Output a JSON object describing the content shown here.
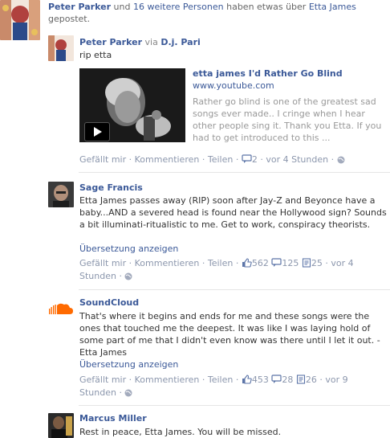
{
  "header": {
    "actor": "Peter Parker",
    "connector": "und",
    "others": "16 weitere Personen",
    "tail": "haben etwas über",
    "topic": "Etta James",
    "tail2": "gepostet."
  },
  "posts": [
    {
      "author": "Peter Parker",
      "via_word": "via",
      "via_name": "D.j. Pari",
      "text": "rip etta",
      "link": {
        "title": "etta james I'd Rather Go Blind",
        "url": "www.youtube.com",
        "description": "Rather go blind is one of the greatest sad songs ever made.. I cringe when I hear other people sing it. Thank you Etta. If you had to get introduced to this ..."
      },
      "actions": {
        "like": "Gefällt mir",
        "comment": "Kommentieren",
        "share": "Teilen",
        "comments": "2",
        "time": "vor 4 Stunden"
      }
    },
    {
      "author": "Sage Francis",
      "text": "Etta James passes away (RIP) soon after Jay-Z and Beyonce have a baby...AND a severed head is found near the Hollywood sign? Sounds a bit illuminati-ritualistic to me. Get to work, conspiracy theorists.",
      "translate": "Übersetzung anzeigen",
      "actions": {
        "like": "Gefällt mir",
        "comment": "Kommentieren",
        "share": "Teilen",
        "likes": "562",
        "comments": "125",
        "shares": "25",
        "time_a": "vor 4",
        "time_b": "Stunden"
      }
    },
    {
      "author": "SoundCloud",
      "text": "That's where it begins and ends for me and these songs were the ones that touched me the deepest. It was like I was laying hold of some part of me that I didn't even know was there until I let it out. - Etta James",
      "translate": "Übersetzung anzeigen",
      "actions": {
        "like": "Gefällt mir",
        "comment": "Kommentieren",
        "share": "Teilen",
        "likes": "453",
        "comments": "28",
        "shares": "26",
        "time_a": "vor 9",
        "time_b": "Stunden"
      }
    },
    {
      "author": "Marcus Miller",
      "text": "Rest in peace, Etta James. You will be missed."
    }
  ],
  "colors": {
    "link": "#3b5998",
    "meta": "#8c97ad",
    "divider": "#e5e5e5",
    "soundcloud": "#ff6a00"
  },
  "icons": [
    "comment-icon",
    "like-icon",
    "share-icon",
    "globe-icon",
    "play-icon",
    "soundcloud-cloud-icon"
  ]
}
